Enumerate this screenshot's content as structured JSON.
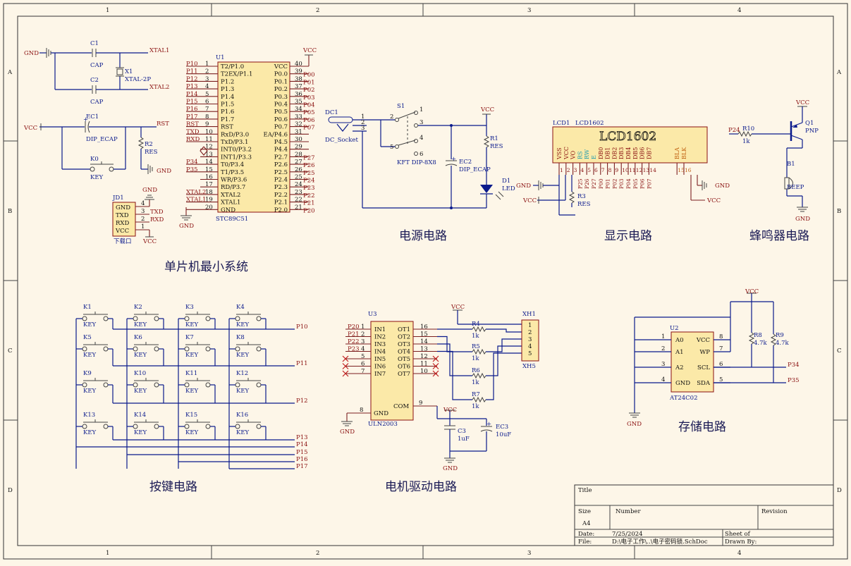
{
  "frame": {
    "columns": [
      "1",
      "2",
      "3",
      "4"
    ],
    "rows": [
      "A",
      "B",
      "C",
      "D"
    ]
  },
  "sections": {
    "mcu": "单片机最小系统",
    "power": "电源电路",
    "display": "显示电路",
    "buzzer": "蜂鸣器电路",
    "keys": "按键电路",
    "motor": "电机驱动电路",
    "storage": "存储电路"
  },
  "mcu": {
    "designator": "U1",
    "part": "STC89C51",
    "left_pins": [
      {
        "net": "P10",
        "num": "1",
        "name": "T2/P1.0"
      },
      {
        "net": "P11",
        "num": "2",
        "name": "T2EX/P1.1"
      },
      {
        "net": "P12",
        "num": "3",
        "name": "P1.2"
      },
      {
        "net": "P13",
        "num": "4",
        "name": "P1.3"
      },
      {
        "net": "P14",
        "num": "5",
        "name": "P1.4"
      },
      {
        "net": "P15",
        "num": "6",
        "name": "P1.5"
      },
      {
        "net": "P16",
        "num": "7",
        "name": "P1.6"
      },
      {
        "net": "P17",
        "num": "8",
        "name": "P1.7"
      },
      {
        "net": "RST",
        "num": "9",
        "name": "RST"
      },
      {
        "net": "TXD",
        "num": "10",
        "name": "RxD/P3.0"
      },
      {
        "net": "RXD",
        "num": "11",
        "name": "TxD/P3.1"
      },
      {
        "net": "",
        "num": "12",
        "name": "INT0/P3.2"
      },
      {
        "net": "",
        "num": "13",
        "name": "INT1/P3.3"
      },
      {
        "net": "P34",
        "num": "14",
        "name": "T0/P3.4"
      },
      {
        "net": "P35",
        "num": "15",
        "name": "T1/P3.5"
      },
      {
        "net": "",
        "num": "16",
        "name": "WR/P3.6"
      },
      {
        "net": "",
        "num": "17",
        "name": "RD/P3.7"
      },
      {
        "net": "XTAL2",
        "num": "18",
        "name": "XTAL2"
      },
      {
        "net": "XTAL1",
        "num": "19",
        "name": "XTAL1"
      },
      {
        "net": "",
        "num": "20",
        "name": "GND"
      }
    ],
    "right_pins": [
      {
        "net": "VCC",
        "num": "40",
        "name": "VCC"
      },
      {
        "net": "P00",
        "num": "39",
        "name": "P0.0"
      },
      {
        "net": "P01",
        "num": "38",
        "name": "P0.1"
      },
      {
        "net": "P02",
        "num": "37",
        "name": "P0.2"
      },
      {
        "net": "P03",
        "num": "36",
        "name": "P0.3"
      },
      {
        "net": "P04",
        "num": "35",
        "name": "P0.4"
      },
      {
        "net": "P05",
        "num": "34",
        "name": "P0.5"
      },
      {
        "net": "P06",
        "num": "33",
        "name": "P0.6"
      },
      {
        "net": "P07",
        "num": "32",
        "name": "P0.7"
      },
      {
        "net": "",
        "num": "31",
        "name": "EA/P4.6"
      },
      {
        "net": "",
        "num": "30",
        "name": "P4.5"
      },
      {
        "net": "",
        "num": "29",
        "name": "P4.4"
      },
      {
        "net": "P27",
        "num": "28",
        "name": "P2.7"
      },
      {
        "net": "P26",
        "num": "27",
        "name": "P2.6"
      },
      {
        "net": "P25",
        "num": "26",
        "name": "P2.5"
      },
      {
        "net": "P24",
        "num": "25",
        "name": "P2.4"
      },
      {
        "net": "P23",
        "num": "24",
        "name": "P2.3"
      },
      {
        "net": "P22",
        "num": "23",
        "name": "P2.2"
      },
      {
        "net": "P21",
        "num": "22",
        "name": "P2.1"
      },
      {
        "net": "P20",
        "num": "21",
        "name": "P2.0"
      }
    ]
  },
  "crystal": {
    "gnd": "GND",
    "c1": "C1",
    "c1_val": "CAP",
    "c2": "C2",
    "c2_val": "CAP",
    "x1": "X1",
    "x1_val": "XTAL-2P",
    "xtal1": "XTAL1",
    "xtal2": "XTAL2"
  },
  "reset": {
    "vcc": "VCC",
    "ec1": "EC1",
    "ec1_val": "DIP_ECAP",
    "rst": "RST",
    "r2": "R2",
    "r2_val": "RES",
    "k0": "K0",
    "k0_val": "KEY",
    "gnd": "GND"
  },
  "download": {
    "designator": "JD1",
    "label": "下载口",
    "pins": [
      "GND",
      "TXD",
      "RXD",
      "VCC"
    ],
    "nums": [
      "4",
      "3",
      "2",
      "1"
    ],
    "gnd": "GND",
    "txd": "TXD",
    "rxd": "RXD",
    "vcc": "VCC",
    "u1_gnd": "GND",
    "u1_vcc": "VCC"
  },
  "power": {
    "dc1": "DC1",
    "dc1_val": "DC_Socket",
    "s1": "S1",
    "s1_val": "KFT DIP-8X8",
    "vcc": "VCC",
    "r1": "R1",
    "r1_val": "RES",
    "ec2": "EC2",
    "ec2_val": "DIP_ECAP",
    "d1": "D1",
    "d1_val": "LED",
    "pins": [
      "1",
      "2",
      "3",
      "4",
      "5",
      "6",
      "1",
      "2",
      "3"
    ]
  },
  "lcd": {
    "designator": "LCD1",
    "part": "LCD1602",
    "title": "LCD1602",
    "pins": [
      "VSS",
      "VCC",
      "VO",
      "RS",
      "RW",
      "E",
      "DB0",
      "DB1",
      "DB2",
      "DB3",
      "DB4",
      "DB5",
      "DB6",
      "DB7",
      "BLA",
      "BLK"
    ],
    "nums": [
      "1",
      "2",
      "3",
      "4",
      "5",
      "6",
      "7",
      "8",
      "9",
      "10",
      "11",
      "12",
      "13",
      "14",
      "15",
      "16"
    ],
    "nets": [
      "",
      "",
      "",
      "P25",
      "P26",
      "P27",
      "P00",
      "P01",
      "P02",
      "P03",
      "P04",
      "P05",
      "P06",
      "P07",
      "",
      ""
    ],
    "gnd": "GND",
    "vcc": "VCC",
    "r3": "R3",
    "r3_val": "RES",
    "gnd2": "GND",
    "vcc2": "VCC"
  },
  "buzzer": {
    "vcc": "VCC",
    "q1": "Q1",
    "q1_val": "PNP",
    "p24": "P24",
    "r10": "R10",
    "r10_val": "1k",
    "b1": "B1",
    "b1_val": "BEEP",
    "gnd": "GND"
  },
  "keypad": {
    "keys": [
      "K1",
      "K2",
      "K3",
      "K4",
      "K5",
      "K6",
      "K7",
      "K8",
      "K9",
      "K10",
      "K11",
      "K12",
      "K13",
      "K14",
      "K15",
      "K16"
    ],
    "key_val": "KEY",
    "row_nets": [
      "P10",
      "P11",
      "P12"
    ],
    "col_nets": [
      "P13",
      "P14",
      "P15",
      "P16",
      "P17"
    ]
  },
  "motor": {
    "designator": "U3",
    "part": "ULN2003",
    "in_nets": [
      "P20",
      "P21",
      "P22",
      "P23"
    ],
    "in_pins": [
      {
        "num": "1",
        "name": "IN1"
      },
      {
        "num": "2",
        "name": "IN2"
      },
      {
        "num": "3",
        "name": "IN3"
      },
      {
        "num": "4",
        "name": "IN4"
      },
      {
        "num": "5",
        "name": "IN5"
      },
      {
        "num": "6",
        "name": "IN6"
      },
      {
        "num": "7",
        "name": "IN7"
      }
    ],
    "out_pins": [
      {
        "num": "16",
        "name": "OT1"
      },
      {
        "num": "15",
        "name": "OT2"
      },
      {
        "num": "14",
        "name": "OT3"
      },
      {
        "num": "13",
        "name": "OT4"
      },
      {
        "num": "12",
        "name": "OT5"
      },
      {
        "num": "11",
        "name": "OT6"
      },
      {
        "num": "10",
        "name": "OT7"
      }
    ],
    "gnd_num": "8",
    "gnd_name": "GND",
    "com_num": "9",
    "com_name": "COM",
    "gnd": "GND",
    "vcc": "VCC",
    "r4": "R4",
    "r5": "R5",
    "r6": "R6",
    "r7": "R7",
    "r_val": "1k",
    "xh1": "XH1",
    "xh_val": "XH5",
    "xh_pins": [
      "1",
      "2",
      "3",
      "4",
      "5"
    ],
    "vcc2": "VCC",
    "c3": "C3",
    "c3_val": "1uF",
    "ec3": "EC3",
    "ec3_val": "10uF",
    "gnd2": "GND"
  },
  "eeprom": {
    "designator": "U2",
    "part": "AT24C02",
    "left": [
      {
        "num": "1",
        "name": "A0"
      },
      {
        "num": "2",
        "name": "A1"
      },
      {
        "num": "3",
        "name": "A2"
      },
      {
        "num": "4",
        "name": "GND"
      }
    ],
    "right": [
      {
        "num": "8",
        "name": "VCC"
      },
      {
        "num": "7",
        "name": "WP"
      },
      {
        "num": "6",
        "name": "SCL"
      },
      {
        "num": "5",
        "name": "SDA"
      }
    ],
    "vcc": "VCC",
    "r8": "R8",
    "r8_val": "4.7k",
    "r9": "R9",
    "r9_val": "4.7k",
    "p34": "P34",
    "p35": "P35",
    "gnd": "GND"
  },
  "title_block": {
    "title_label": "Title",
    "size_label": "Size",
    "size_value": "A4",
    "number_label": "Number",
    "revision_label": "Revision",
    "date_label": "Date:",
    "date_value": "7/25/2024",
    "sheet_label": "Sheet  of",
    "file_label": "File:",
    "file_value": "D:\\电子工作\\..\\电子密码锁.SchDoc",
    "drawn_label": "Drawn By:"
  },
  "colors": {
    "wire": "#0a1a8c",
    "part_body": "#fbe9a8",
    "net_label": "#8a1010",
    "background": "#fdf6e8"
  }
}
